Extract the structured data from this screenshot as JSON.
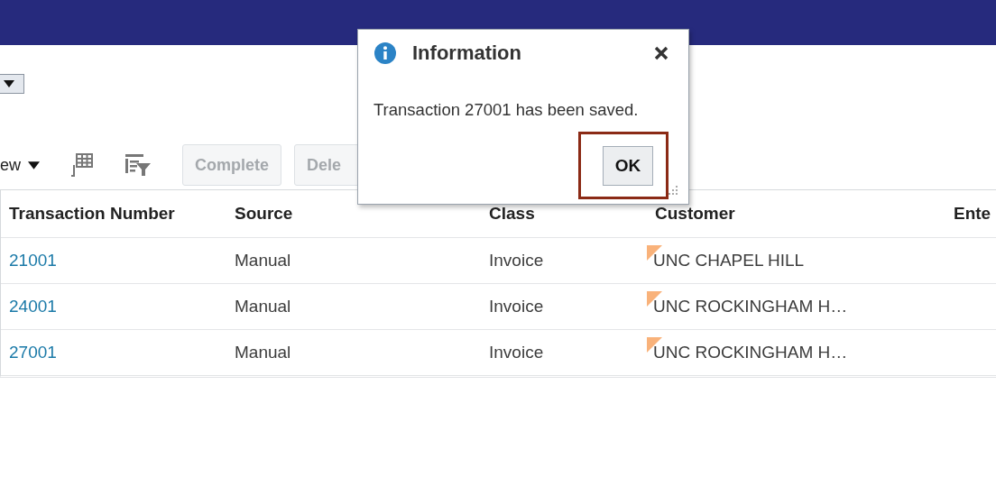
{
  "toolbar": {
    "view_menu": "ew",
    "buttons": [
      {
        "label": "Complete",
        "disabled": true
      },
      {
        "label": "Dele",
        "disabled": true
      }
    ]
  },
  "table": {
    "columns": [
      "Transaction Number",
      "Source",
      "Class",
      "Customer",
      "Ente"
    ],
    "rows": [
      {
        "number": "21001",
        "source": "Manual",
        "class": "Invoice",
        "customer": "UNC CHAPEL HILL",
        "flagged": true
      },
      {
        "number": "24001",
        "source": "Manual",
        "class": "Invoice",
        "customer": "UNC ROCKINGHAM H…",
        "flagged": true
      },
      {
        "number": "27001",
        "source": "Manual",
        "class": "Invoice",
        "customer": "UNC ROCKINGHAM H…",
        "flagged": true
      }
    ]
  },
  "dialog": {
    "title": "Information",
    "message": "Transaction 27001 has been saved.",
    "button": "OK",
    "button_highlighted": true
  }
}
